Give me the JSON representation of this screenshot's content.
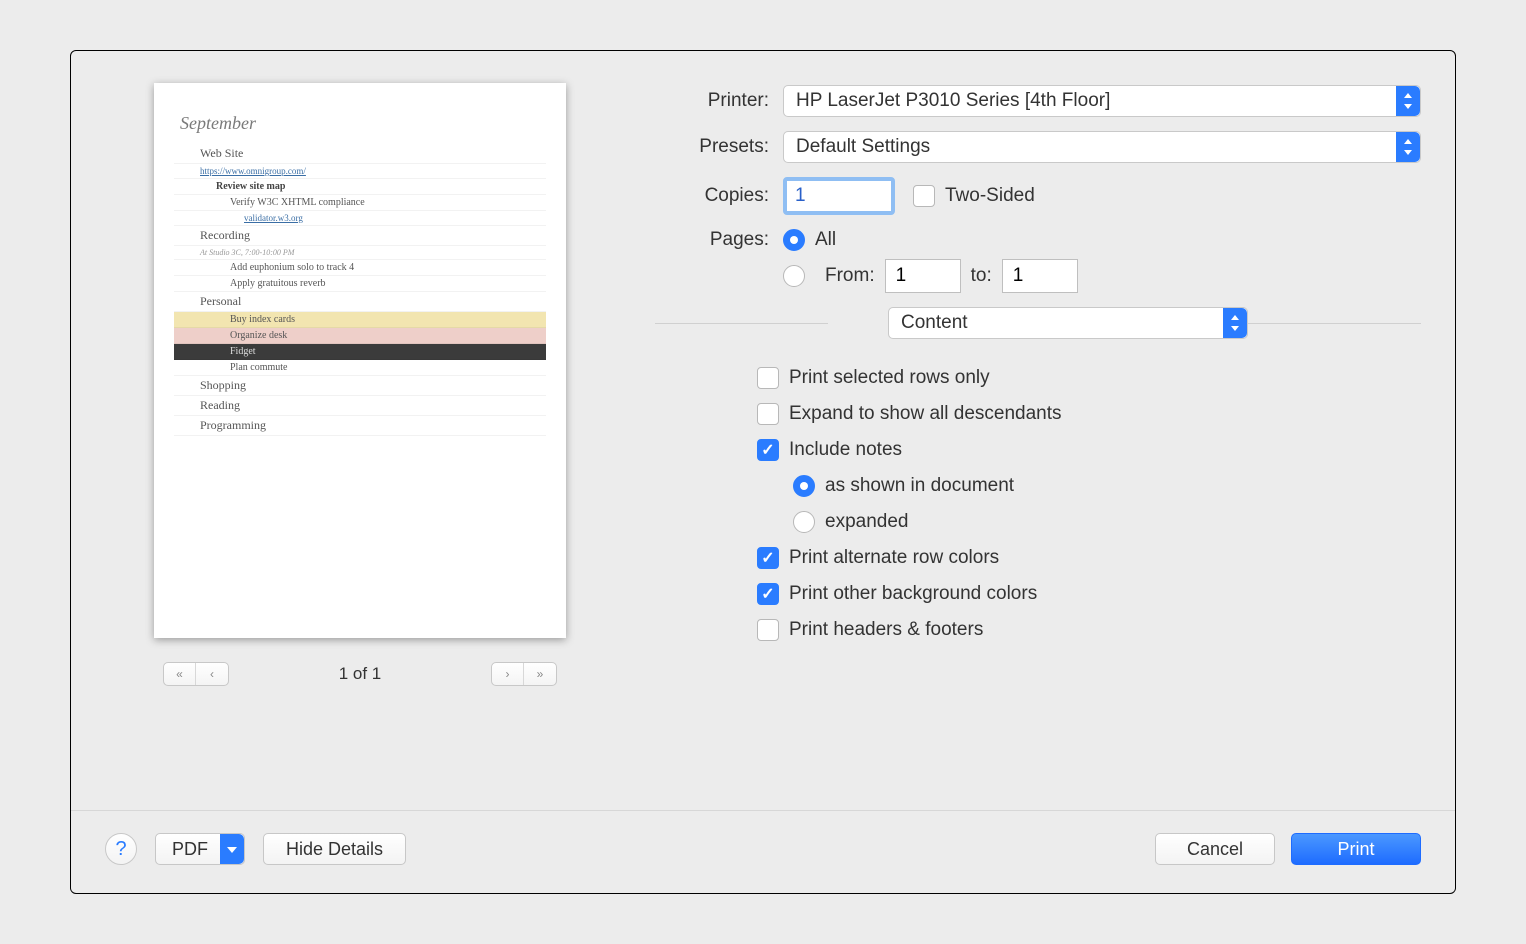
{
  "preview": {
    "title": "September",
    "lines": [
      {
        "cls": "pv-l1",
        "text": "Web Site"
      },
      {
        "cls": "pv-lk",
        "text": "https://www.omnigroup.com/"
      },
      {
        "cls": "pv-l2",
        "text": "Review site map"
      },
      {
        "cls": "pv-l3",
        "text": "Verify W3C XHTML compliance"
      },
      {
        "cls": "pv-l4",
        "text": "validator.w3.org"
      },
      {
        "cls": "pv-l1",
        "text": "Recording"
      },
      {
        "cls": "pv-note",
        "text": "At Studio 3C, 7:00-10:00 PM"
      },
      {
        "cls": "pv-l3",
        "text": "Add euphonium solo to track 4"
      },
      {
        "cls": "pv-l3",
        "text": "Apply gratuitous reverb"
      },
      {
        "cls": "pv-l1",
        "text": "Personal"
      },
      {
        "cls": "pv-l3",
        "text": "Buy index cards",
        "rowcls": "row-yellow"
      },
      {
        "cls": "pv-l3",
        "text": "Organize desk",
        "rowcls": "row-pink"
      },
      {
        "cls": "pv-l3",
        "text": "Fidget",
        "rowcls": "row-dark"
      },
      {
        "cls": "pv-l3",
        "text": "Plan commute"
      },
      {
        "cls": "pv-l1",
        "text": "Shopping"
      },
      {
        "cls": "pv-l1",
        "text": "Reading"
      },
      {
        "cls": "pv-l1",
        "text": "Programming"
      }
    ],
    "page_indicator": "1 of 1"
  },
  "form": {
    "printer_label": "Printer:",
    "printer_value": "HP LaserJet P3010 Series [4th Floor]",
    "presets_label": "Presets:",
    "presets_value": "Default Settings",
    "copies_label": "Copies:",
    "copies_value": "1",
    "two_sided_label": "Two-Sided",
    "pages_label": "Pages:",
    "pages_all": "All",
    "pages_from": "From:",
    "pages_from_val": "1",
    "pages_to": "to:",
    "pages_to_val": "1",
    "section_value": "Content",
    "opt_selected_rows": "Print selected rows only",
    "opt_expand_desc": "Expand to show all descendants",
    "opt_include_notes": "Include notes",
    "opt_notes_shown": "as shown in document",
    "opt_notes_expanded": "expanded",
    "opt_alt_rows": "Print alternate row colors",
    "opt_bg_colors": "Print other background colors",
    "opt_headers": "Print headers & footers"
  },
  "footer": {
    "pdf": "PDF",
    "hide_details": "Hide Details",
    "cancel": "Cancel",
    "print": "Print"
  }
}
